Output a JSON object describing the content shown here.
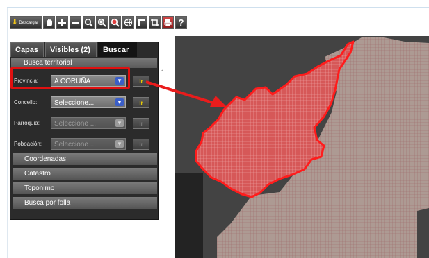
{
  "toolbar": {
    "download_label": "Descargar",
    "tools": [
      {
        "icon": "pan-hand-icon"
      },
      {
        "icon": "zoom-in-plus-icon"
      },
      {
        "icon": "zoom-out-minus-icon"
      },
      {
        "icon": "zoom-box-icon"
      },
      {
        "icon": "zoom-extent-icon"
      },
      {
        "icon": "zoom-previous-icon"
      },
      {
        "icon": "globe-icon"
      },
      {
        "icon": "measure-icon"
      },
      {
        "icon": "crop-icon"
      },
      {
        "icon": "print-icon"
      },
      {
        "icon": "help-icon",
        "label": "?"
      }
    ]
  },
  "tabs": [
    {
      "label": "Capas",
      "active": false
    },
    {
      "label": "Visibles (2)",
      "active": false
    },
    {
      "label": "Buscar",
      "active": true
    }
  ],
  "search": {
    "section_title": "Busca territorial",
    "fields": [
      {
        "label": "Provincia:",
        "value": "A CORUÑA",
        "button": "Ir",
        "enabled": true
      },
      {
        "label": "Concello:",
        "value": "Seleccione...",
        "button": "Ir",
        "enabled": true
      },
      {
        "label": "Parroquia:",
        "value": "Seleccione ...",
        "button": "Ir",
        "enabled": false
      },
      {
        "label": "Poboación:",
        "value": "Seleccione ...",
        "button": "Ir",
        "enabled": false
      }
    ],
    "collapsed_sections": [
      "Coordenadas",
      "Catastro",
      "Toponimo",
      "Busca por folla"
    ]
  },
  "colors": {
    "highlight": "#e01010",
    "panel_bg": "#2b2b2b",
    "map_bg": "#454545",
    "selected_region": "#d45252"
  }
}
